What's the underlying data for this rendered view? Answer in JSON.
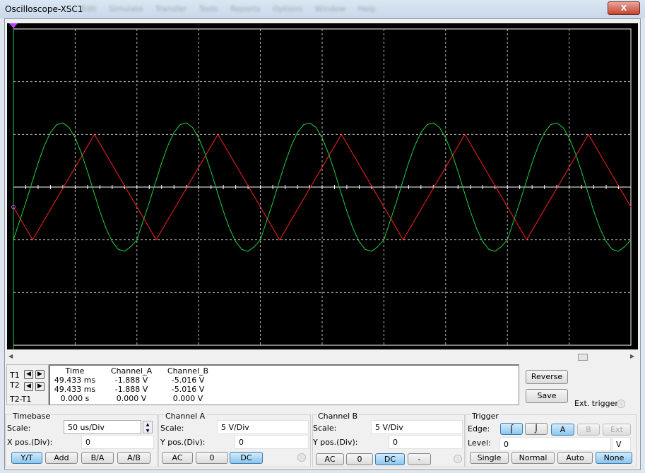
{
  "window": {
    "title": "Oscilloscope-XSC1",
    "close_label": "X"
  },
  "cursors": {
    "t1_label": "T1",
    "t2_label": "T2",
    "diff_label": "T2-T1"
  },
  "readout": {
    "headers": [
      "Time",
      "Channel_A",
      "Channel_B"
    ],
    "rows": [
      [
        "49.433 ms",
        "-1.888 V",
        "-5.016 V"
      ],
      [
        "49.433 ms",
        "-1.888 V",
        "-5.016 V"
      ],
      [
        "0.000 s",
        "0.000 V",
        "0.000 V"
      ]
    ]
  },
  "buttons": {
    "reverse": "Reverse",
    "save": "Save",
    "ext_trigger": "Ext. trigger"
  },
  "timebase": {
    "title": "Timebase",
    "scale_label": "Scale:",
    "scale": "50 us/Div",
    "xpos_label": "X pos.(Div):",
    "xpos": "0",
    "modes": [
      "Y/T",
      "Add",
      "B/A",
      "A/B"
    ],
    "active_mode": "Y/T"
  },
  "channel_a": {
    "title": "Channel A",
    "scale_label": "Scale:",
    "scale": "5  V/Div",
    "ypos_label": "Y pos.(Div):",
    "ypos": "0",
    "coupling": [
      "AC",
      "0",
      "DC"
    ],
    "active": "DC"
  },
  "channel_b": {
    "title": "Channel B",
    "scale_label": "Scale:",
    "scale": "5  V/Div",
    "ypos_label": "Y pos.(Div):",
    "ypos": "0",
    "coupling": [
      "AC",
      "0",
      "DC",
      "-"
    ],
    "active": "DC"
  },
  "trigger": {
    "title": "Trigger",
    "edge_label": "Edge:",
    "edges": [
      "rising-edge-icon",
      "falling-edge-icon"
    ],
    "sources": [
      "A",
      "B",
      "Ext"
    ],
    "active_source": "A",
    "level_label": "Level:",
    "level": "0",
    "level_unit": "V",
    "modes": [
      "Single",
      "Normal",
      "Auto",
      "None"
    ],
    "active_mode": "None"
  },
  "chart_data": {
    "type": "line",
    "xlim": [
      0,
      500
    ],
    "ylim": [
      -15,
      15
    ],
    "x_unit": "us",
    "y_unit": "V",
    "grid": true,
    "x_divisions": 10,
    "y_divisions": 6,
    "series": [
      {
        "channel": "A",
        "color": "#ff2020",
        "points": [
          [
            0,
            -1.888
          ],
          [
            15.6,
            -5
          ],
          [
            65.6,
            5
          ],
          [
            115.6,
            -5
          ],
          [
            165.6,
            5
          ],
          [
            215.6,
            -5
          ],
          [
            265.6,
            5
          ],
          [
            315.6,
            -5
          ],
          [
            365.6,
            5
          ],
          [
            415.6,
            -5
          ],
          [
            465.6,
            5
          ],
          [
            500,
            -1.88
          ]
        ]
      },
      {
        "channel": "B",
        "color": "#20d040",
        "cycle_period": 100,
        "cycle_step": 5,
        "cycle_values": [
          -5.0,
          -3.23,
          -1.48,
          0.43,
          2.29,
          3.92,
          5.17,
          5.92,
          6.09,
          5.66,
          4.67,
          3.23,
          1.48,
          -0.43,
          -2.29,
          -3.92,
          -5.17,
          -5.92,
          -6.09,
          -5.66
        ]
      }
    ],
    "cursor_time": 0
  }
}
